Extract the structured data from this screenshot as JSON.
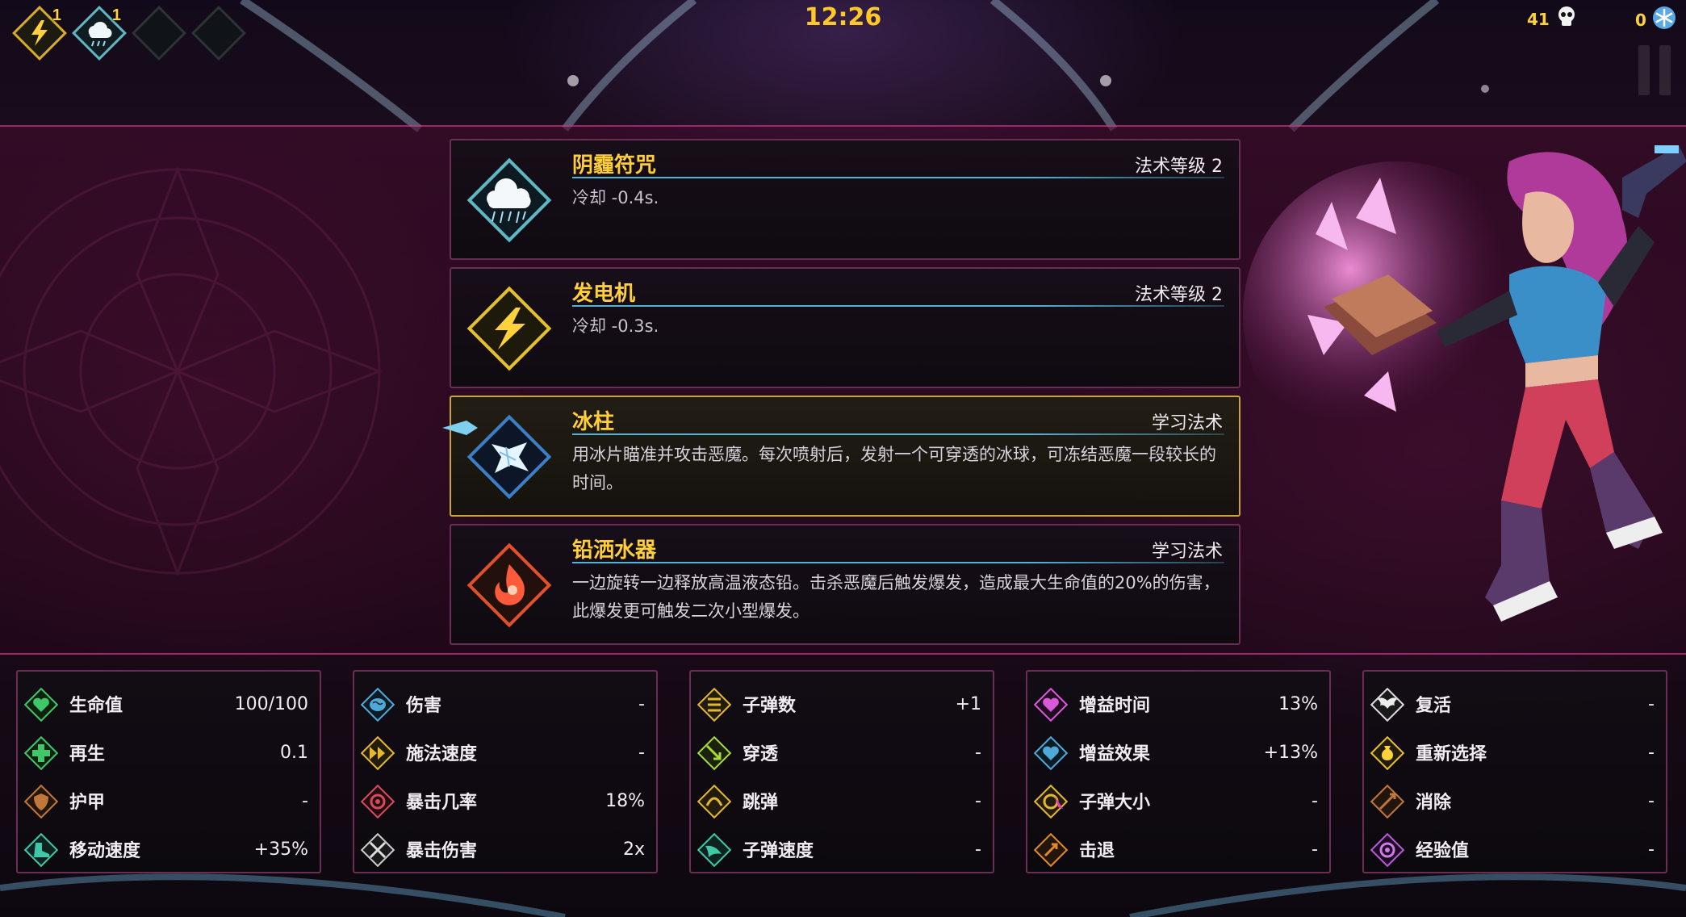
{
  "hud": {
    "timer": "12:26",
    "slots": [
      {
        "icon": "lightning-rune-icon",
        "count": "1",
        "style": "gold"
      },
      {
        "icon": "storm-cloud-icon",
        "count": "1",
        "style": "teal"
      },
      {
        "icon": "empty-slot-icon",
        "count": "",
        "style": "empty"
      },
      {
        "icon": "empty-slot-icon",
        "count": "",
        "style": "empty"
      }
    ],
    "kills": "41",
    "kills_icon": "skull-icon",
    "gems": "0",
    "gems_icon": "snowflake-icon"
  },
  "cards": [
    {
      "name": "阴霾符咒",
      "level": "法术等级 2",
      "desc": "冷却 -0.4s.",
      "icon": "storm-cloud-icon",
      "accent": "#5fb7c4",
      "selected": false
    },
    {
      "name": "发电机",
      "level": "法术等级 2",
      "desc": "冷却 -0.3s.",
      "icon": "lightning-icon",
      "accent": "#e6c02c",
      "selected": false
    },
    {
      "name": "冰柱",
      "level": "学习法术",
      "desc": "用冰片瞄准并攻击恶魔。每次喷射后，发射一个可穿透的冰球，可冻结恶魔一段较长的时间。",
      "icon": "ice-shard-icon",
      "accent": "#3d7fc4",
      "selected": true
    },
    {
      "name": "铅洒水器",
      "level": "学习法术",
      "desc": "一边旋转一边释放高温液态铅。击杀恶魔后触发爆发，造成最大生命值的20%的伤害，此爆发更可触发二次小型爆发。",
      "icon": "molten-lead-icon",
      "accent": "#e0502a",
      "selected": false
    }
  ],
  "stats": [
    [
      {
        "label": "生命值",
        "value": "100/100",
        "icon": "heart-icon",
        "color": "#3fc76a"
      },
      {
        "label": "再生",
        "value": "0.1",
        "icon": "plus-icon",
        "color": "#3fc76a"
      },
      {
        "label": "护甲",
        "value": "-",
        "icon": "shield-icon",
        "color": "#c0783a"
      },
      {
        "label": "移动速度",
        "value": "+35%",
        "icon": "boot-icon",
        "color": "#3fc7a8"
      }
    ],
    [
      {
        "label": "伤害",
        "value": "-",
        "icon": "brain-icon",
        "color": "#4fa9d8"
      },
      {
        "label": "施法速度",
        "value": "-",
        "icon": "fast-forward-icon",
        "color": "#e6b82c"
      },
      {
        "label": "暴击几率",
        "value": "18%",
        "icon": "crit-chance-icon",
        "color": "#d84a5a"
      },
      {
        "label": "暴击伤害",
        "value": "2x",
        "icon": "crit-damage-icon",
        "color": "#cccccc"
      }
    ],
    [
      {
        "label": "子弹数",
        "value": "+1",
        "icon": "bullets-icon",
        "color": "#e6b82c"
      },
      {
        "label": "穿透",
        "value": "-",
        "icon": "pierce-arrow-icon",
        "color": "#a8d83c"
      },
      {
        "label": "跳弹",
        "value": "-",
        "icon": "bounce-icon",
        "color": "#e6b82c"
      },
      {
        "label": "子弹速度",
        "value": "-",
        "icon": "wing-icon",
        "color": "#3fc7a8"
      }
    ],
    [
      {
        "label": "增益时间",
        "value": "13%",
        "icon": "buff-time-icon",
        "color": "#d85ad8"
      },
      {
        "label": "增益效果",
        "value": "+13%",
        "icon": "buff-effect-icon",
        "color": "#4fa9d8"
      },
      {
        "label": "子弹大小",
        "value": "-",
        "icon": "bullet-size-icon",
        "color": "#e6b82c"
      },
      {
        "label": "击退",
        "value": "-",
        "icon": "knockback-icon",
        "color": "#e08a2c"
      }
    ],
    [
      {
        "label": "复活",
        "value": "-",
        "icon": "revive-wings-icon",
        "color": "#dddddd"
      },
      {
        "label": "重新选择",
        "value": "-",
        "icon": "reroll-bag-icon",
        "color": "#e6c02c"
      },
      {
        "label": "消除",
        "value": "-",
        "icon": "banish-icon",
        "color": "#c0783a"
      },
      {
        "label": "经验值",
        "value": "-",
        "icon": "xp-orb-icon",
        "color": "#b85ad8"
      }
    ]
  ]
}
